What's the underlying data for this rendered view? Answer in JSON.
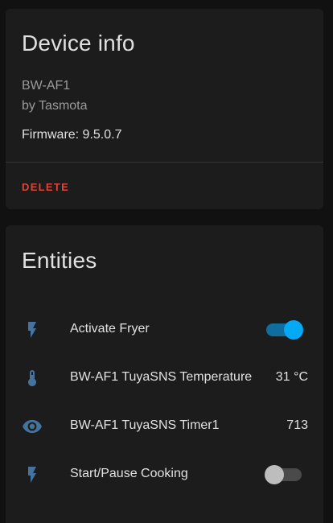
{
  "device_info": {
    "title": "Device info",
    "model": "BW-AF1",
    "manufacturer": "by Tasmota",
    "firmware": "Firmware: 9.5.0.7",
    "delete_label": "DELETE"
  },
  "entities": {
    "title": "Entities",
    "items": [
      {
        "icon": "flash-icon",
        "name": "Activate Fryer",
        "type": "switch",
        "state": "on"
      },
      {
        "icon": "thermometer-icon",
        "name": "BW-AF1 TuyaSNS Temperature",
        "type": "sensor",
        "state": "31 °C"
      },
      {
        "icon": "eye-icon",
        "name": "BW-AF1 TuyaSNS Timer1",
        "type": "sensor",
        "state": "713"
      },
      {
        "icon": "flash-icon",
        "name": "Start/Pause Cooking",
        "type": "switch",
        "state": "off"
      }
    ]
  },
  "colors": {
    "background": "#111111",
    "card": "#1c1c1c",
    "icon": "#44739e",
    "accent": "#03a9f4",
    "delete": "#db4437"
  }
}
